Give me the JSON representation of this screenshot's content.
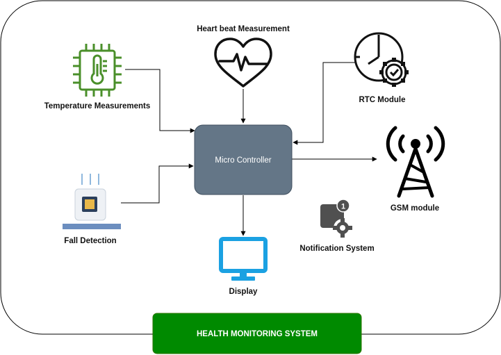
{
  "labels": {
    "heartbeat": "Heart beat Measurement",
    "temperature": "Temperature Measurements",
    "rtc": "RTC Module",
    "microcontroller": "Micro Controller",
    "gsm": "GSM module",
    "fall": "Fall Detection",
    "notification": "Notification System",
    "notification_badge": "1",
    "display": "Display",
    "system_title": "HEALTH MONITORING SYSTEM"
  },
  "colors": {
    "microcontroller_fill": "#647687",
    "title_fill": "#008a00",
    "temperature_icon": "#4a8f2a",
    "display_icon": "#1ba1e2"
  },
  "icons": {
    "heartbeat": "heart-pulse-icon",
    "temperature": "thermometer-chip-icon",
    "rtc": "clock-gear-icon",
    "gsm": "signal-tower-icon",
    "fall": "chip-sensor-icon",
    "notification": "notification-gear-icon",
    "display": "monitor-icon"
  }
}
